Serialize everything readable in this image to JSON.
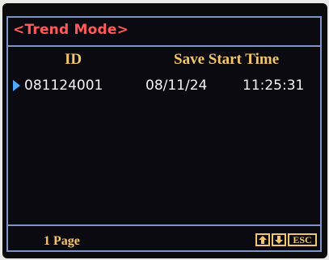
{
  "screen": {
    "title": "<Trend Mode>"
  },
  "table": {
    "headers": {
      "id": "ID",
      "save_start_time": "Save Start Time"
    },
    "rows": [
      {
        "id": "081124001",
        "date": "08/11/24",
        "time": "11:25:31",
        "selected": true
      }
    ]
  },
  "footer": {
    "page_label": "1 Page",
    "keys": {
      "up": "up-arrow-icon",
      "down": "down-arrow-icon",
      "esc": "ESC"
    }
  },
  "colors": {
    "title": "#ff5a5a",
    "header": "#f2c66a",
    "frame": "#7e93c8",
    "cursor": "#4fa9ff",
    "text": "#f4f4f4"
  }
}
